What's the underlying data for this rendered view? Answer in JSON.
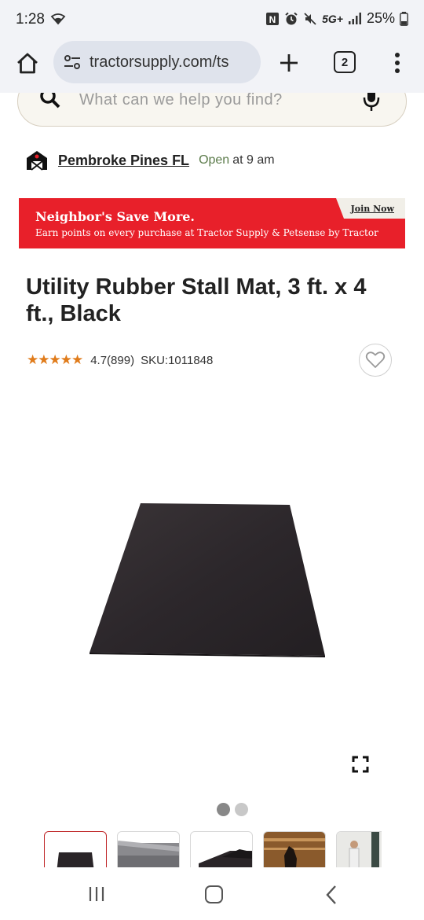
{
  "status": {
    "time": "1:28",
    "network": "5G+",
    "battery": "25%"
  },
  "browser": {
    "url": "tractorsupply.com/ts",
    "tab_count": "2"
  },
  "search": {
    "placeholder": "What can we help you find?"
  },
  "store": {
    "name": "Pembroke Pines FL",
    "open_label": "Open",
    "hours": "at 9 am"
  },
  "promo": {
    "title": "Neighbor's Save More.",
    "subtitle": "Earn points on every purchase at Tractor Supply & Petsense by Tractor",
    "join_label": "Join Now",
    "color": "#e8202a"
  },
  "product": {
    "title": "Utility Rubber Stall Mat, 3 ft. x 4 ft., Black",
    "stars": "★★★★★",
    "rating": 4.7,
    "rating_text": "4.7(899)",
    "sku": "SKU:1011848"
  },
  "gallery": {
    "current_slide": 1,
    "slide_count": 2,
    "thumbnails": [
      "mat-black",
      "mat-texture",
      "mat-corner",
      "horse-stall",
      "person-stall"
    ]
  },
  "colors": {
    "accent_red": "#c0282a",
    "star_orange": "#e07b1a",
    "open_green": "#5b7b4a"
  }
}
